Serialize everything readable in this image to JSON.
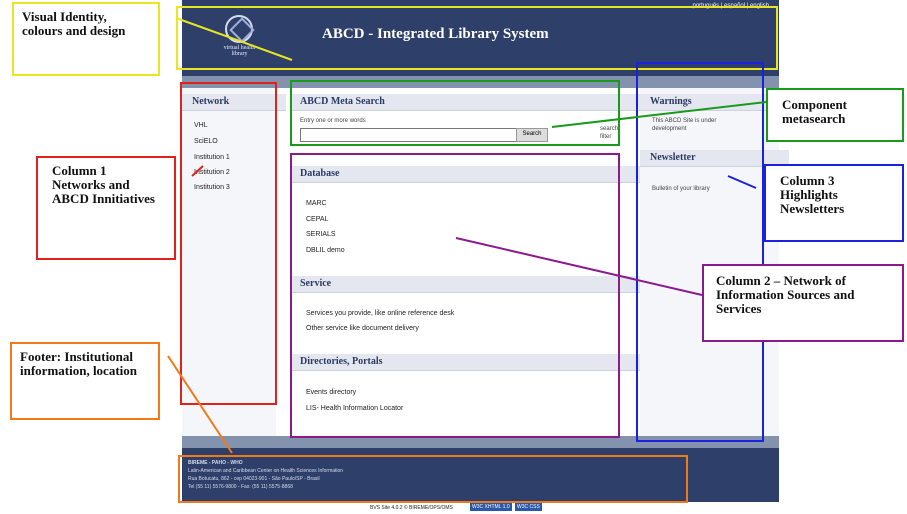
{
  "header": {
    "lang_links": "português | español | english",
    "logo_text": "virtual health library",
    "title": "ABCD - Integrated Library System"
  },
  "col1": {
    "heading": "Network",
    "items": [
      "VHL",
      "SciELO",
      "Institution 1",
      "Institution 2",
      "Institution 3"
    ]
  },
  "col2": {
    "metasearch": {
      "heading": "ABCD Meta Search",
      "prompt": "Entry one or more words",
      "input_value": "",
      "button": "Search",
      "side_label": "search filter"
    },
    "database": {
      "heading": "Database",
      "items": [
        "MARC",
        "CEPAL",
        "SERIALS",
        "DBLIL demo"
      ]
    },
    "service": {
      "heading": "Service",
      "items": [
        "Services you provide, like online reference desk",
        "Other service like document delivery"
      ]
    },
    "directories": {
      "heading": "Directories, Portals",
      "items": [
        "Events directory",
        "LIS- Health Information Locator"
      ]
    }
  },
  "col3": {
    "warnings": {
      "heading": "Warnings",
      "text": "This ABCD Site is under development"
    },
    "newsletter": {
      "heading": "Newsletter",
      "text": "Bulletin of your library"
    }
  },
  "footer": {
    "lines": [
      "BIREME - PAHO - WHO",
      "Latin-American and Caribbean Center on Health Sciences Information",
      "Rua Botucatu, 862 - cep 04023-901 - São Paulo/SP - Brasil",
      "Tel (55 11) 5576-9800 - Fax: (55 11) 5575-8868"
    ],
    "credit": "BVS Site 4.0.2 © BIREME/OPS/OMS",
    "badges": [
      "W3C XHTML 1.0",
      "W3C CSS"
    ]
  },
  "annotations": {
    "visual_identity": "Visual Identity, colours and design",
    "column1": "Column 1 Networks and ABCD Innitiatives",
    "footer": "Footer: Institutional information, location",
    "metasearch": "Component metasearch",
    "column3": "Column 3 Highlights Newsletters",
    "column2": "Column 2 – Network of Information Sources and Services"
  },
  "colors": {
    "header_navy": "#2e3f6a",
    "strip": "#8393ad",
    "visual_identity": "#e8e620",
    "column1": "#e0221b",
    "metasearch": "#1a9a1a",
    "column3": "#1a22e0",
    "column2": "#8a1a8e",
    "footer": "#f07a1a"
  }
}
